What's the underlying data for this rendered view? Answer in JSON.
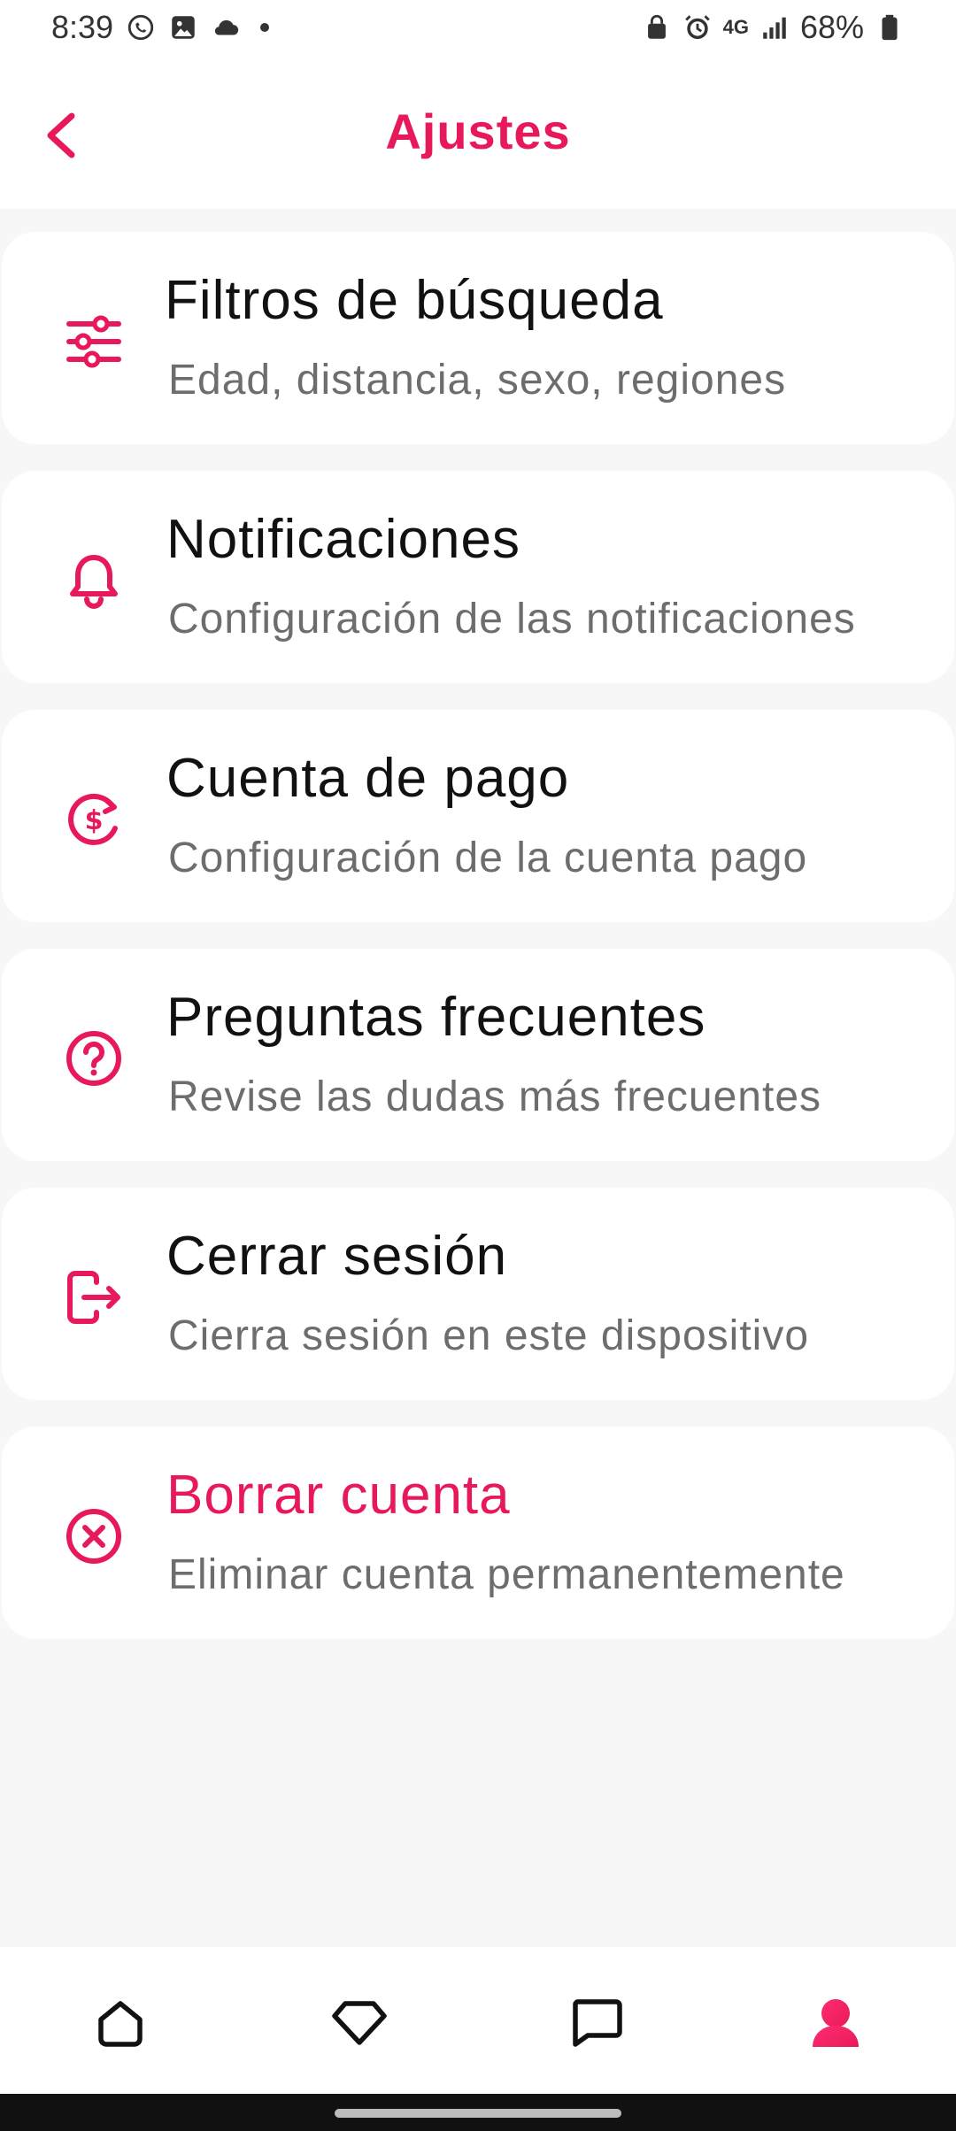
{
  "status_bar": {
    "time": "8:39",
    "battery": "68%",
    "network": "4G"
  },
  "header": {
    "title": "Ajustes",
    "accent_color": "#e8195a"
  },
  "settings_items": [
    {
      "title": "Filtros de búsqueda",
      "subtitle": "Edad, distancia, sexo, regiones",
      "icon": "sliders-icon"
    },
    {
      "title": "Notificaciones",
      "subtitle": "Configuración de las notificaciones",
      "icon": "bell-icon"
    },
    {
      "title": "Cuenta de pago",
      "subtitle": "Configuración de la cuenta pago",
      "icon": "payment-cycle-icon"
    },
    {
      "title": "Preguntas frecuentes",
      "subtitle": "Revise las dudas más frecuentes",
      "icon": "question-circle-icon"
    },
    {
      "title": "Cerrar sesión",
      "subtitle": "Cierra sesión en este dispositivo",
      "icon": "logout-icon"
    },
    {
      "title": "Borrar cuenta",
      "subtitle": "Eliminar cuenta permanentemente",
      "icon": "close-circle-icon",
      "danger": true
    }
  ],
  "bottom_nav": [
    {
      "icon": "home-icon",
      "active": false
    },
    {
      "icon": "diamond-icon",
      "active": false
    },
    {
      "icon": "chat-icon",
      "active": false
    },
    {
      "icon": "profile-icon",
      "active": true
    }
  ]
}
